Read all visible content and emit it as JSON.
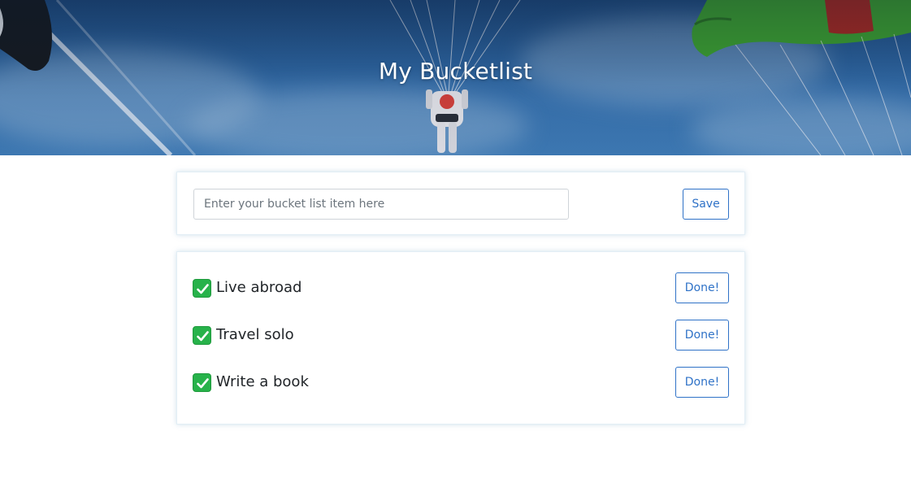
{
  "hero": {
    "title": "My Bucketlist"
  },
  "form": {
    "placeholder": "Enter your bucket list item here",
    "value": "",
    "save_label": "Save"
  },
  "items": [
    {
      "check_icon": "check-mark-icon",
      "label": "Live abroad",
      "done_label": "Done!"
    },
    {
      "check_icon": "check-mark-icon",
      "label": "Travel solo",
      "done_label": "Done!"
    },
    {
      "check_icon": "check-mark-icon",
      "label": "Write a book",
      "done_label": "Done!"
    }
  ],
  "colors": {
    "accent": "#2f72c7",
    "check": "#27b24a",
    "text": "#212529",
    "card_border": "#e2eef5"
  }
}
